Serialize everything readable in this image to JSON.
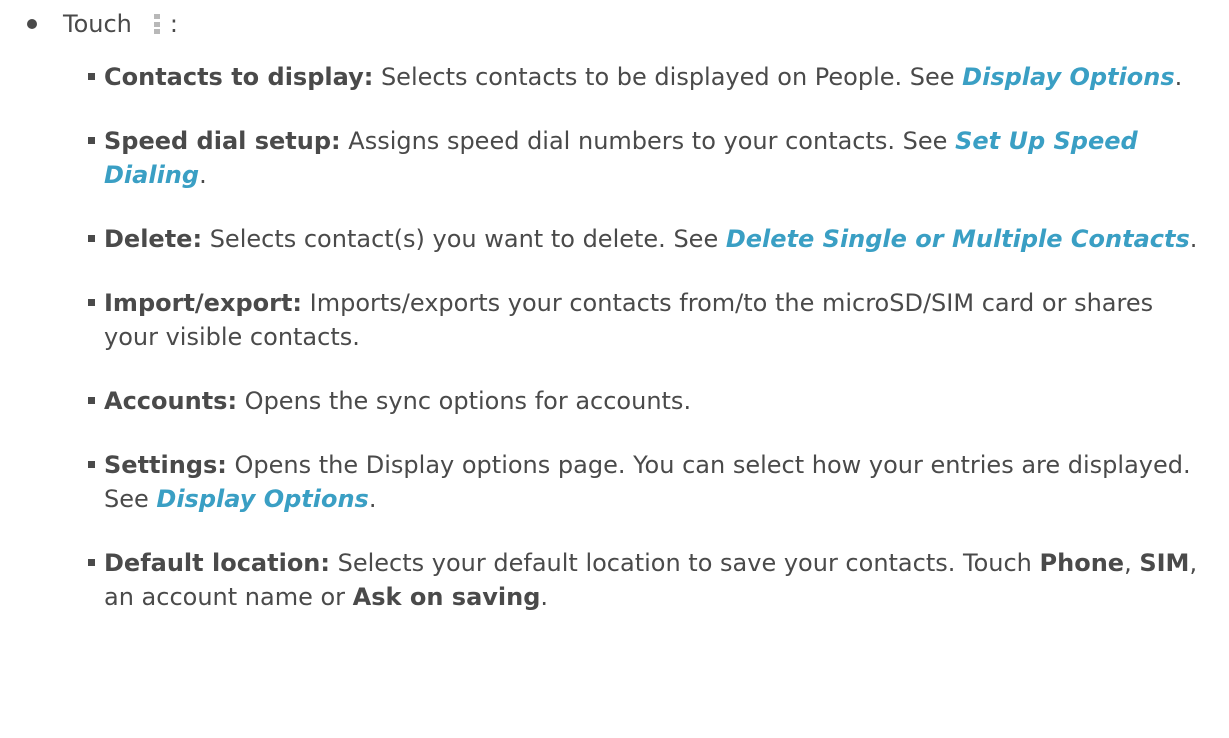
{
  "intro": {
    "text": "Touch",
    "suffix": ":"
  },
  "items": [
    {
      "term": "Contacts to display:",
      "text": " Selects contacts to be displayed on People. See ",
      "link": "Display Options",
      "end": "."
    },
    {
      "term": "Speed dial setup:",
      "text": " Assigns speed dial numbers to your contacts. See ",
      "link": "Set Up Speed Dialing",
      "end": "."
    },
    {
      "term": "Delete:",
      "text": " Selects contact(s) you want to delete. See ",
      "link": "Delete Single or Multiple Contacts",
      "end": "."
    },
    {
      "term": "Import/export:",
      "text": " Imports/exports your contacts from/to the microSD/SIM card or shares your visible contacts."
    },
    {
      "term": "Accounts:",
      "text": " Opens the sync options for accounts."
    },
    {
      "term": "Settings:",
      "text": " Opens the Display options page. You can select how your entries are displayed. See ",
      "link": "Display Options",
      "end": "."
    },
    {
      "term": "Default location:",
      "text": " Selects your default location to save your contacts. Touch ",
      "phone": "Phone",
      "sep1": ", ",
      "sim": "SIM",
      "mid": ", an account name or ",
      "ask": "Ask on saving",
      "end": "."
    }
  ]
}
